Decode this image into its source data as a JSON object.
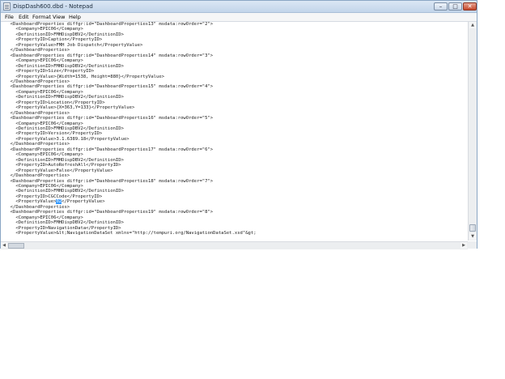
{
  "window": {
    "title": "DispDash600.dbd - Notepad",
    "buttons": {
      "minimize": "–",
      "maximize": "□",
      "close": "✕"
    }
  },
  "menu": [
    "File",
    "Edit",
    "Format",
    "View",
    "Help"
  ],
  "editor": {
    "selected_text": "02",
    "lines": [
      "  <DashboardProperties diffgr:id=\"DashboardProperties13\" msdata:rowOrder=\"2\">",
      "    <Company>EPIC06</Company>",
      "    <DefinitionID>FMHDispDBV2</DefinitionID>",
      "    <PropertyID>Caption</PropertyID>",
      "    <PropertyValue>FMH Job Dispatch</PropertyValue>",
      "  </DashboardProperties>",
      "  <DashboardProperties diffgr:id=\"DashboardProperties14\" msdata:rowOrder=\"3\">",
      "    <Company>EPIC06</Company>",
      "    <DefinitionID>FMHDispDBV2</DefinitionID>",
      "    <PropertyID>Size</PropertyID>",
      "    <PropertyValue>{Width=1538, Height=880}</PropertyValue>",
      "  </DashboardProperties>",
      "  <DashboardProperties diffgr:id=\"DashboardProperties15\" msdata:rowOrder=\"4\">",
      "    <Company>EPIC06</Company>",
      "    <DefinitionID>FMHDispDBV2</DefinitionID>",
      "    <PropertyID>Location</PropertyID>",
      "    <PropertyValue>{X=363,Y=133}</PropertyValue>",
      "  </DashboardProperties>",
      "  <DashboardProperties diffgr:id=\"DashboardProperties16\" msdata:rowOrder=\"5\">",
      "    <Company>EPIC06</Company>",
      "    <DefinitionID>FMHDispDBV2</DefinitionID>",
      "    <PropertyID>Version</PropertyID>",
      "    <PropertyValue>3.1.6389.18</PropertyValue>",
      "  </DashboardProperties>",
      "  <DashboardProperties diffgr:id=\"DashboardProperties17\" msdata:rowOrder=\"6\">",
      "    <Company>EPIC06</Company>",
      "    <DefinitionID>FMHDispDBV2</DefinitionID>",
      "    <PropertyID>AutoRefreshAll</PropertyID>",
      "    <PropertyValue>False</PropertyValue>",
      "  </DashboardProperties>",
      "  <DashboardProperties diffgr:id=\"DashboardProperties18\" msdata:rowOrder=\"7\">",
      "    <Company>EPIC06</Company>",
      "    <DefinitionID>FMHDispDBV2</DefinitionID>",
      "    <PropertyID>CGCCode</PropertyID>",
      "    <PropertyValue>02</PropertyValue>",
      "  </DashboardProperties>",
      "  <DashboardProperties diffgr:id=\"DashboardProperties19\" msdata:rowOrder=\"8\">",
      "    <Company>EPIC06</Company>",
      "    <DefinitionID>FMHDispDBV2</DefinitionID>",
      "    <PropertyID>NavigationData</PropertyID>",
      "    <PropertyValue>&lt;NavigationDataSet xmlns=\"http://tempuri.org/NavigationDataSet.xsd\"&gt;"
    ]
  },
  "colors": {
    "selection": "#3399ff",
    "titlebar": "#c2d5ea",
    "close_button": "#c4472b"
  }
}
